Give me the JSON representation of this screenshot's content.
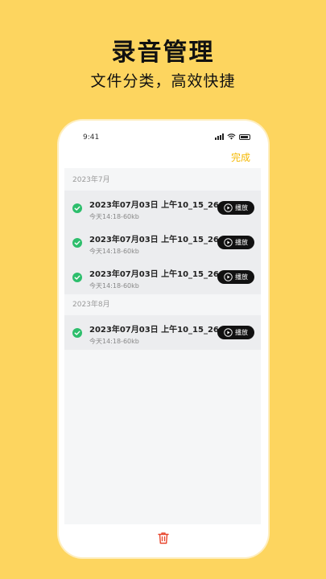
{
  "promo": {
    "headline": "录音管理",
    "subhead": "文件分类，高效快捷"
  },
  "status_bar": {
    "time": "9:41"
  },
  "toolbar": {
    "done_label": "完成"
  },
  "groups": [
    {
      "label": "2023年7月",
      "items": [
        {
          "title": "2023年07月03日 上午10_15_26",
          "meta": "今天14:18-60kb",
          "play_label": "播放"
        },
        {
          "title": "2023年07月03日 上午10_15_26",
          "meta": "今天14:18-60kb",
          "play_label": "播放"
        },
        {
          "title": "2023年07月03日 上午10_15_26",
          "meta": "今天14:18-60kb",
          "play_label": "播放"
        }
      ]
    },
    {
      "label": "2023年8月",
      "items": [
        {
          "title": "2023年07月03日 上午10_15_26",
          "meta": "今天14:18-60kb",
          "play_label": "播放"
        }
      ]
    }
  ],
  "colors": {
    "background": "#FDD55F",
    "accent": "#F5B800",
    "check": "#2DBE6C",
    "delete": "#E8452C"
  },
  "icons": {
    "check": "check-circle-icon",
    "play": "play-circle-icon",
    "delete": "trash-icon"
  }
}
